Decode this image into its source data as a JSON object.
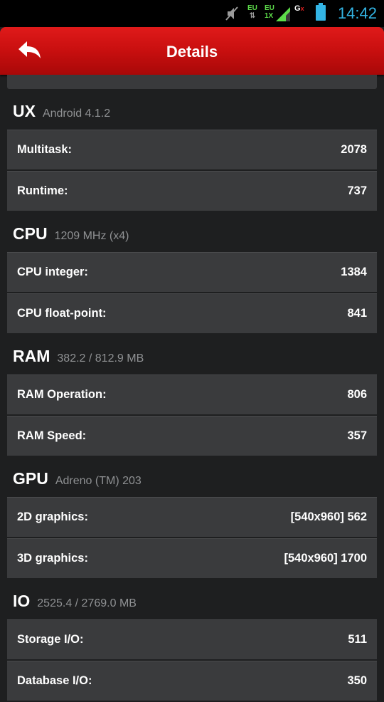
{
  "status_bar": {
    "time": "14:42",
    "icons": [
      "mute-icon",
      "data-eu-icon",
      "signal-eu-1x-icon",
      "g-icon",
      "battery-icon"
    ],
    "eu1": "EU",
    "eu2": "EU",
    "eu2_sub": "1X",
    "accent_color": "#33b5e5"
  },
  "header": {
    "title": "Details",
    "back_icon": "back-arrow-icon",
    "color": "#c80f0f"
  },
  "sections": [
    {
      "title": "UX",
      "subtitle": "Android 4.1.2",
      "rows": [
        {
          "label": "Multitask:",
          "value": "2078"
        },
        {
          "label": "Runtime:",
          "value": "737"
        }
      ]
    },
    {
      "title": "CPU",
      "subtitle": "1209 MHz (x4)",
      "rows": [
        {
          "label": "CPU integer:",
          "value": "1384"
        },
        {
          "label": "CPU float-point:",
          "value": "841"
        }
      ]
    },
    {
      "title": "RAM",
      "subtitle": "382.2 / 812.9 MB",
      "rows": [
        {
          "label": "RAM Operation:",
          "value": "806"
        },
        {
          "label": "RAM Speed:",
          "value": "357"
        }
      ]
    },
    {
      "title": "GPU",
      "subtitle": "Adreno (TM) 203",
      "rows": [
        {
          "label": "2D graphics:",
          "value": "[540x960] 562"
        },
        {
          "label": "3D graphics:",
          "value": "[540x960] 1700"
        }
      ]
    },
    {
      "title": "IO",
      "subtitle": "2525.4 / 2769.0 MB",
      "rows": [
        {
          "label": "Storage I/O:",
          "value": "511"
        },
        {
          "label": "Database I/O:",
          "value": "350"
        }
      ]
    }
  ]
}
